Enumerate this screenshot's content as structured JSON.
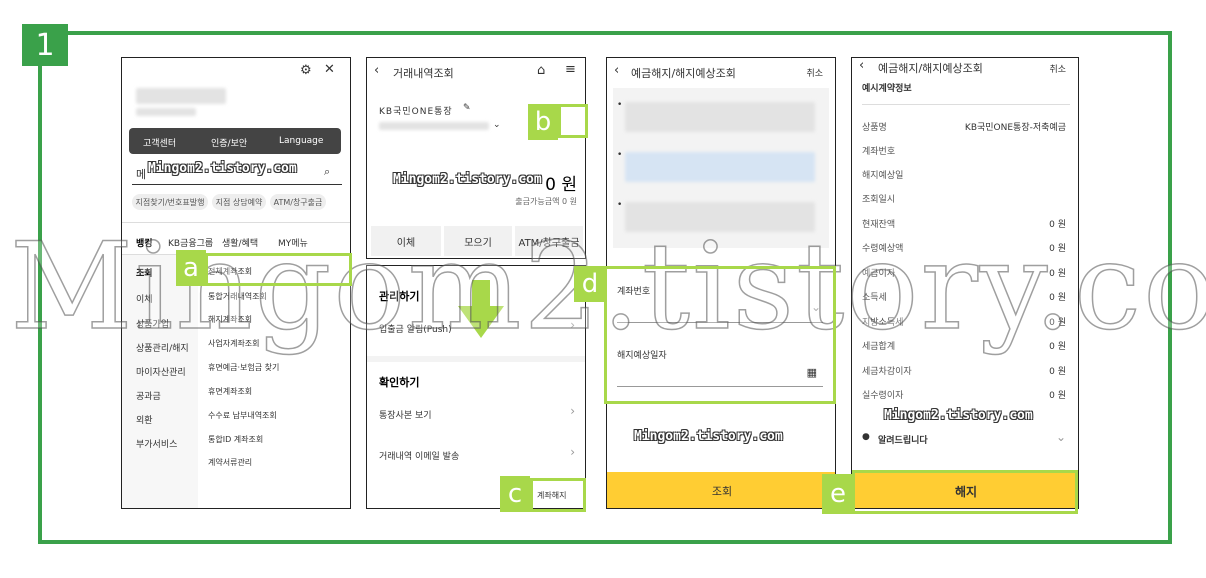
{
  "step_number": "1",
  "watermark_text": "Mingom2.tistory.com",
  "big_watermark": "Mingom2.tistory.com",
  "markers": {
    "a": "a",
    "b": "b",
    "c": "c",
    "d": "d",
    "e": "e"
  },
  "screen1": {
    "menu_buttons": [
      "고객센터",
      "인증/보안",
      "Language"
    ],
    "search_prefix": "메",
    "quick_pills": [
      "지점찾기/번호표발행",
      "지점 상담예약",
      "ATM/창구출금"
    ],
    "tabs": [
      "뱅킹",
      "KB금융그룹",
      "생활/혜택",
      "MY메뉴"
    ],
    "left_menu": [
      "조회",
      "이체",
      "상품가입",
      "상품관리/해지",
      "마이자산관리",
      "공과금",
      "외환",
      "부가서비스"
    ],
    "sub_menu": [
      "전체계좌조회",
      "통합거래내역조회",
      "해지계좌조회",
      "사업자계좌조회",
      "휴면예금·보험금 찾기",
      "휴면계좌조회",
      "수수료 납부내역조회",
      "통합ID 계좌조회",
      "계약서류관리"
    ]
  },
  "screen2": {
    "title": "거래내역조회",
    "account_name": "KB국민ONE통장",
    "balance": "0 원",
    "available": "출금가능금액 0 원",
    "buttons": [
      "이체",
      "모으기",
      "ATM/창구출금"
    ]
  },
  "screen3": {
    "section1": "관리하기",
    "push": "입출금 알림(Push)",
    "section2": "확인하기",
    "item1": "통장사본 보기",
    "item2": "거래내역 이메일 발송",
    "close_btn": "계좌해지"
  },
  "screen4": {
    "title": "예금해지/해지예상조회",
    "cancel": "취소",
    "account_label": "계좌번호",
    "date_label": "해지예상일자",
    "button": "조회"
  },
  "screen5": {
    "title": "예금해지/해지예상조회",
    "cancel": "취소",
    "subtitle": "예시계약정보",
    "rows": [
      {
        "label": "상품명",
        "value": "KB국민ONE통장-저축예금"
      },
      {
        "label": "계좌번호",
        "value": ""
      },
      {
        "label": "해지예상일",
        "value": ""
      },
      {
        "label": "조회일시",
        "value": ""
      },
      {
        "label": "현재잔액",
        "value": "0 원"
      },
      {
        "label": "수령예상액",
        "value": "0 원"
      },
      {
        "label": "예금이자",
        "value": "0 원"
      },
      {
        "label": "소득세",
        "value": "0 원"
      },
      {
        "label": "지방소득세",
        "value": "0 원"
      },
      {
        "label": "세금합계",
        "value": "0 원"
      },
      {
        "label": "세금차감이자",
        "value": "0 원"
      },
      {
        "label": "실수령이자",
        "value": "0 원"
      }
    ],
    "notice": "알려드립니다",
    "button": "해지"
  },
  "colors": {
    "frame": "#3aa14a",
    "marker": "#a8d84a",
    "button": "#ffcd33"
  }
}
